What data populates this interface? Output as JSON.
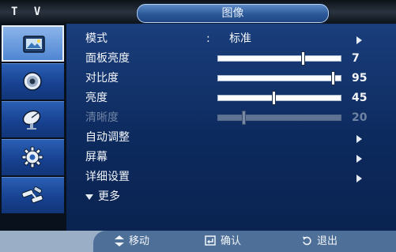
{
  "header": {
    "tv_label": "T V",
    "title": "图像"
  },
  "sidebar": {
    "items": [
      {
        "icon": "picture-icon",
        "active": true
      },
      {
        "icon": "speaker-icon",
        "active": false
      },
      {
        "icon": "satellite-dish-icon",
        "active": false
      },
      {
        "icon": "gear-icon",
        "active": false
      },
      {
        "icon": "input-plugs-icon",
        "active": false
      }
    ]
  },
  "menu": {
    "mode": {
      "label": "模式",
      "colon": ":",
      "value": "标准"
    },
    "backlight": {
      "label": "面板亮度",
      "value": "7",
      "level": 0.7
    },
    "contrast": {
      "label": "对比度",
      "value": "95",
      "level": 0.95
    },
    "brightness": {
      "label": "亮度",
      "value": "45",
      "level": 0.45
    },
    "sharpness": {
      "label": "清晰度",
      "value": "20",
      "level": 0.2,
      "disabled": true
    },
    "auto_adjust": {
      "label": "自动调整"
    },
    "screen": {
      "label": "屏幕"
    },
    "detail_settings": {
      "label": "详细设置"
    },
    "more": {
      "label": "更多"
    }
  },
  "footer": {
    "move": "移动",
    "confirm": "确认",
    "exit": "退出"
  },
  "colors": {
    "panel": "#12336c",
    "active_tab": "#6d9ee0",
    "footer": "#4e6f97"
  }
}
